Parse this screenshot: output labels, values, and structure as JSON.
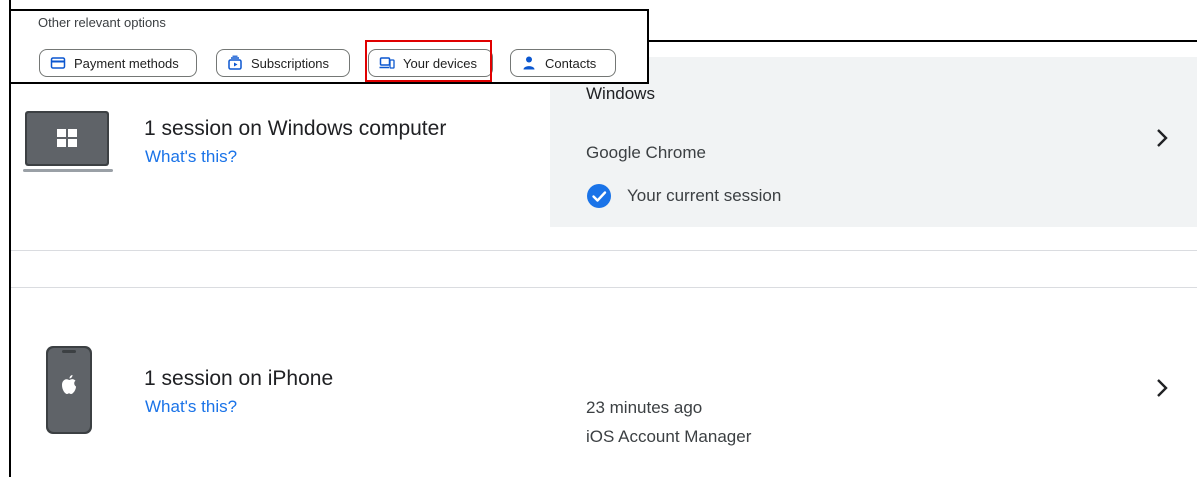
{
  "options": {
    "title": "Other relevant options",
    "chips": [
      {
        "label": "Payment methods",
        "icon": "credit-card-icon"
      },
      {
        "label": "Subscriptions",
        "icon": "subscriptions-icon"
      },
      {
        "label": "Your devices",
        "icon": "devices-icon"
      },
      {
        "label": "Contacts",
        "icon": "person-icon"
      }
    ]
  },
  "devices": [
    {
      "title": "1 session on Windows computer",
      "link": "What's this?",
      "os": "Windows",
      "browser": "Google Chrome",
      "current": "Your current session",
      "icon": "laptop-icon"
    },
    {
      "title": "1 session on iPhone",
      "link": "What's this?",
      "time": "23 minutes ago",
      "app": "iOS Account Manager",
      "icon": "iphone-icon"
    }
  ],
  "colors": {
    "link": "#1a73e8",
    "highlight": "#e00000",
    "panel": "#f1f3f4",
    "check": "#1a73e8"
  }
}
